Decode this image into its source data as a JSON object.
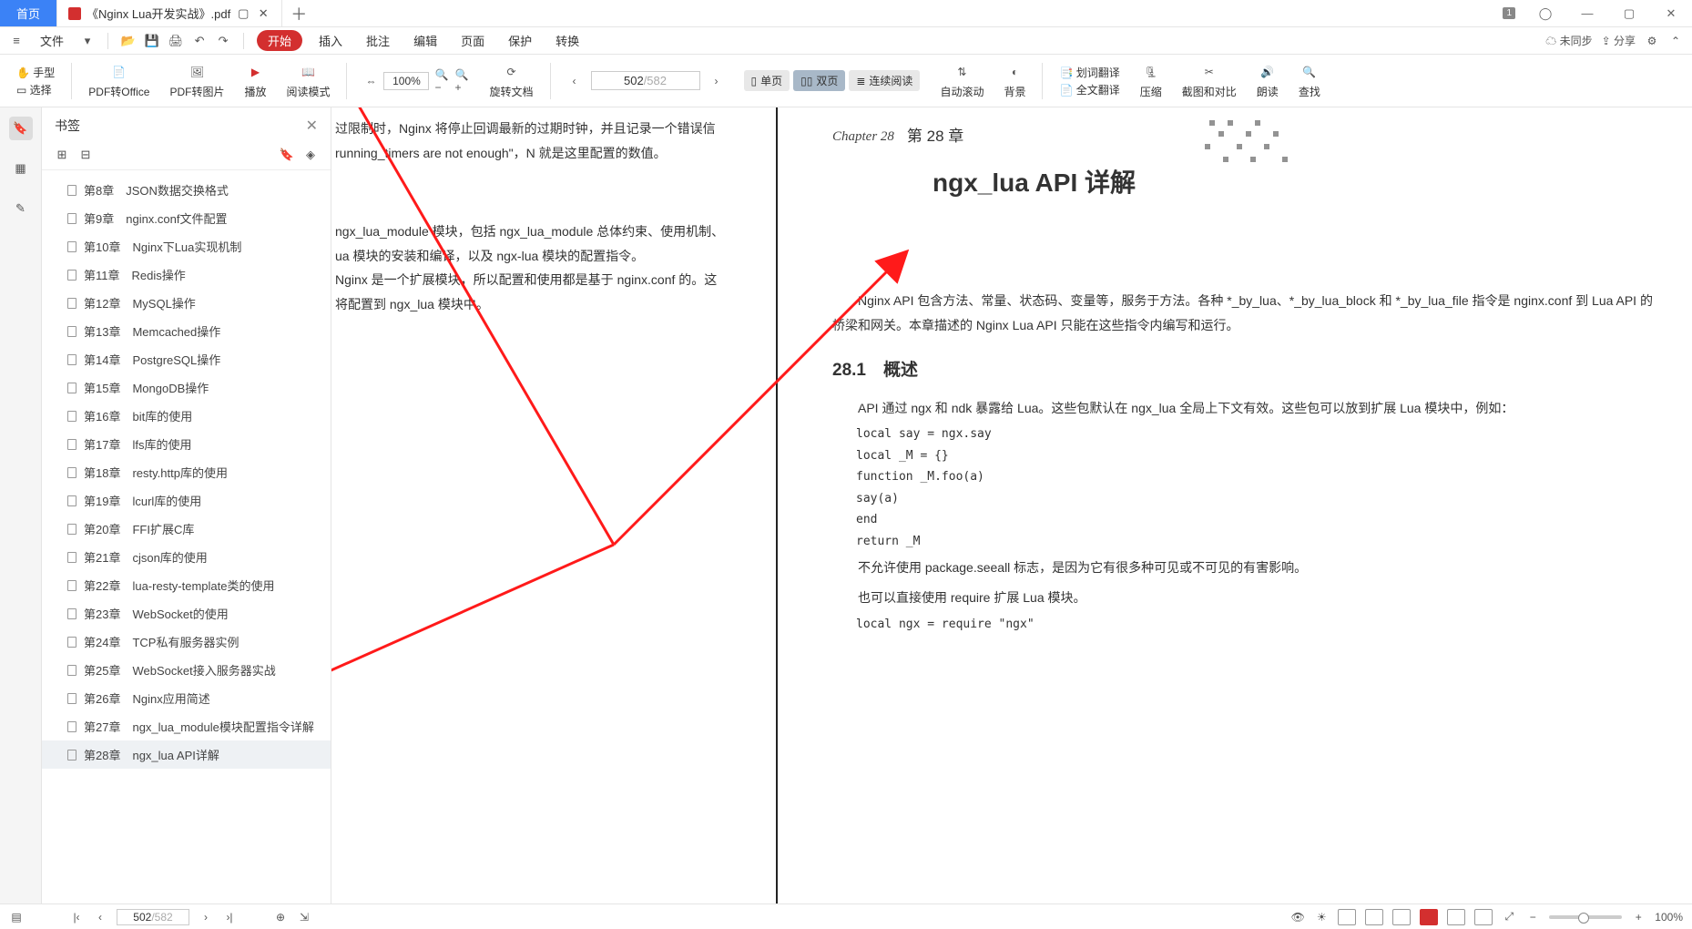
{
  "tabs": {
    "home": "首页",
    "file": "《Nginx Lua开发实战》.pdf"
  },
  "menubar": {
    "file": "文件",
    "start": "开始",
    "insert": "插入",
    "review": "批注",
    "edit": "编辑",
    "page": "页面",
    "protect": "保护",
    "convert": "转换",
    "nosync": "未同步",
    "share": "分享"
  },
  "badge": "1",
  "toolbar": {
    "hand": "手型",
    "select": "选择",
    "pdf2office": "PDF转Office",
    "pdf2img": "PDF转图片",
    "play": "播放",
    "readmode": "阅读模式",
    "zoom": "100%",
    "rotate": "旋转文档",
    "single": "单页",
    "double": "双页",
    "continuous": "连续阅读",
    "autoscroll": "自动滚动",
    "background": "背景",
    "wordtrans": "划词翻译",
    "fulltrans": "全文翻译",
    "compress": "压缩",
    "screenshot": "截图和对比",
    "readaloud": "朗读",
    "find": "查找",
    "page_cur": "502",
    "page_tot": "/582"
  },
  "sidebar": {
    "title": "书签",
    "items": [
      {
        "ch": "第8章",
        "t": "JSON数据交换格式"
      },
      {
        "ch": "第9章",
        "t": "nginx.conf文件配置"
      },
      {
        "ch": "第10章",
        "t": "Nginx下Lua实现机制"
      },
      {
        "ch": "第11章",
        "t": "Redis操作"
      },
      {
        "ch": "第12章",
        "t": "MySQL操作"
      },
      {
        "ch": "第13章",
        "t": "Memcached操作"
      },
      {
        "ch": "第14章",
        "t": "PostgreSQL操作"
      },
      {
        "ch": "第15章",
        "t": "MongoDB操作"
      },
      {
        "ch": "第16章",
        "t": "bit库的使用"
      },
      {
        "ch": "第17章",
        "t": "lfs库的使用"
      },
      {
        "ch": "第18章",
        "t": "resty.http库的使用"
      },
      {
        "ch": "第19章",
        "t": "lcurl库的使用"
      },
      {
        "ch": "第20章",
        "t": "FFI扩展C库"
      },
      {
        "ch": "第21章",
        "t": "cjson库的使用"
      },
      {
        "ch": "第22章",
        "t": "lua-resty-template类的使用"
      },
      {
        "ch": "第23章",
        "t": "WebSocket的使用"
      },
      {
        "ch": "第24章",
        "t": "TCP私有服务器实例"
      },
      {
        "ch": "第25章",
        "t": "WebSocket接入服务器实战"
      },
      {
        "ch": "第26章",
        "t": "Nginx应用简述"
      },
      {
        "ch": "第27章",
        "t": "ngx_lua_module模块配置指令详解"
      },
      {
        "ch": "第28章",
        "t": "ngx_lua API详解"
      }
    ],
    "selected": 20
  },
  "doc": {
    "left": {
      "l1": "过限制时，Nginx 将停止回调最新的过期时钟，并且记录一个错误信",
      "l2": "running_timers are not enough\"，N 就是这里配置的数值。",
      "l3": "ngx_lua_module 模块，包括 ngx_lua_module 总体约束、使用机制、",
      "l4": "ua 模块的安装和编译，以及 ngx-lua 模块的配置指令。",
      "l5": "Nginx 是一个扩展模块，所以配置和使用都是基于 nginx.conf 的。这",
      "l6": "将配置到 ngx_lua 模块中。"
    },
    "right": {
      "chlbl": "Chapter 28",
      "chno": "第 28 章",
      "title": "ngx_lua API 详解",
      "intro": "Nginx API 包含方法、常量、状态码、变量等，服务于方法。各种 *_by_lua、*_by_lua_block 和 *_by_lua_file 指令是 nginx.conf 到 Lua API 的桥梁和网关。本章描述的 Nginx Lua API 只能在这些指令内编写和运行。",
      "sec": "28.1　概述",
      "p1": "API 通过 ngx 和 ndk 暴露给 Lua。这些包默认在 ngx_lua 全局上下文有效。这些包可以放到扩展 Lua 模块中，例如：",
      "c1": "local say = ngx.say",
      "c2": "local _M = {}",
      "c3": "function _M.foo(a)",
      "c4": "    say(a)",
      "c5": "end",
      "c6": "return _M",
      "p2": "不允许使用 package.seeall 标志，是因为它有很多种可见或不可见的有害影响。",
      "p3": "也可以直接使用 require 扩展 Lua 模块。",
      "c7": "local ngx = require \"ngx\""
    }
  },
  "status": {
    "page_cur": "502",
    "page_tot": "/582",
    "zoom": "100%"
  }
}
